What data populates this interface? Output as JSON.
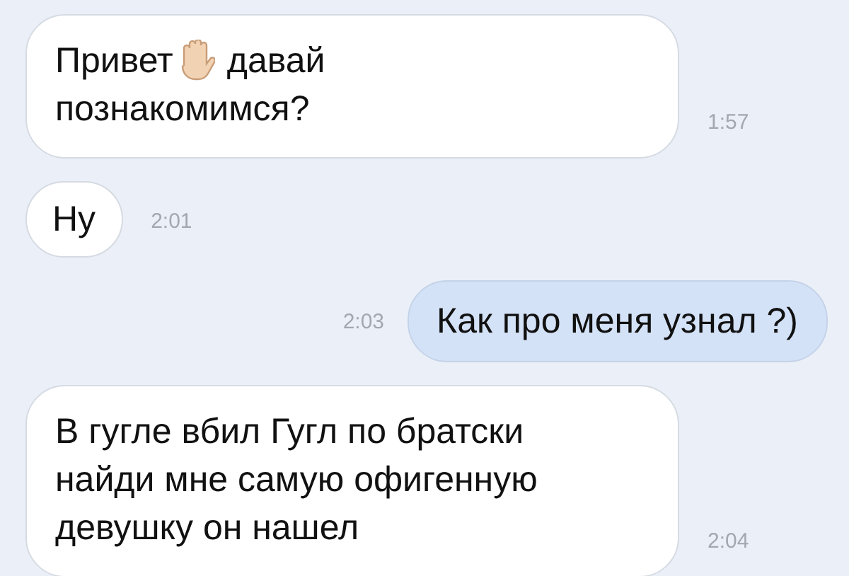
{
  "messages": [
    {
      "kind": "incoming",
      "lines": [
        [
          {
            "kind": "text",
            "text": "Привет"
          },
          {
            "kind": "icon"
          },
          {
            "kind": "text",
            "text": "давай"
          }
        ],
        [
          {
            "kind": "text",
            "text": "познакомимся?"
          }
        ]
      ],
      "time": "1:57"
    },
    {
      "kind": "incoming",
      "lines": [
        [
          {
            "kind": "text",
            "text": "Ну"
          }
        ]
      ],
      "time": "2:01"
    },
    {
      "kind": "outgoing",
      "lines": [
        [
          {
            "kind": "text",
            "text": "Как про меня узнал ?)"
          }
        ]
      ],
      "time": "2:03"
    },
    {
      "kind": "incoming",
      "lines": [
        [
          {
            "kind": "text",
            "text": "В гугле вбил Гугл по братски"
          }
        ],
        [
          {
            "kind": "text",
            "text": "найди мне самую офигенную"
          }
        ],
        [
          {
            "kind": "text",
            "text": "девушку он нашел"
          }
        ]
      ],
      "time": "2:04"
    }
  ]
}
